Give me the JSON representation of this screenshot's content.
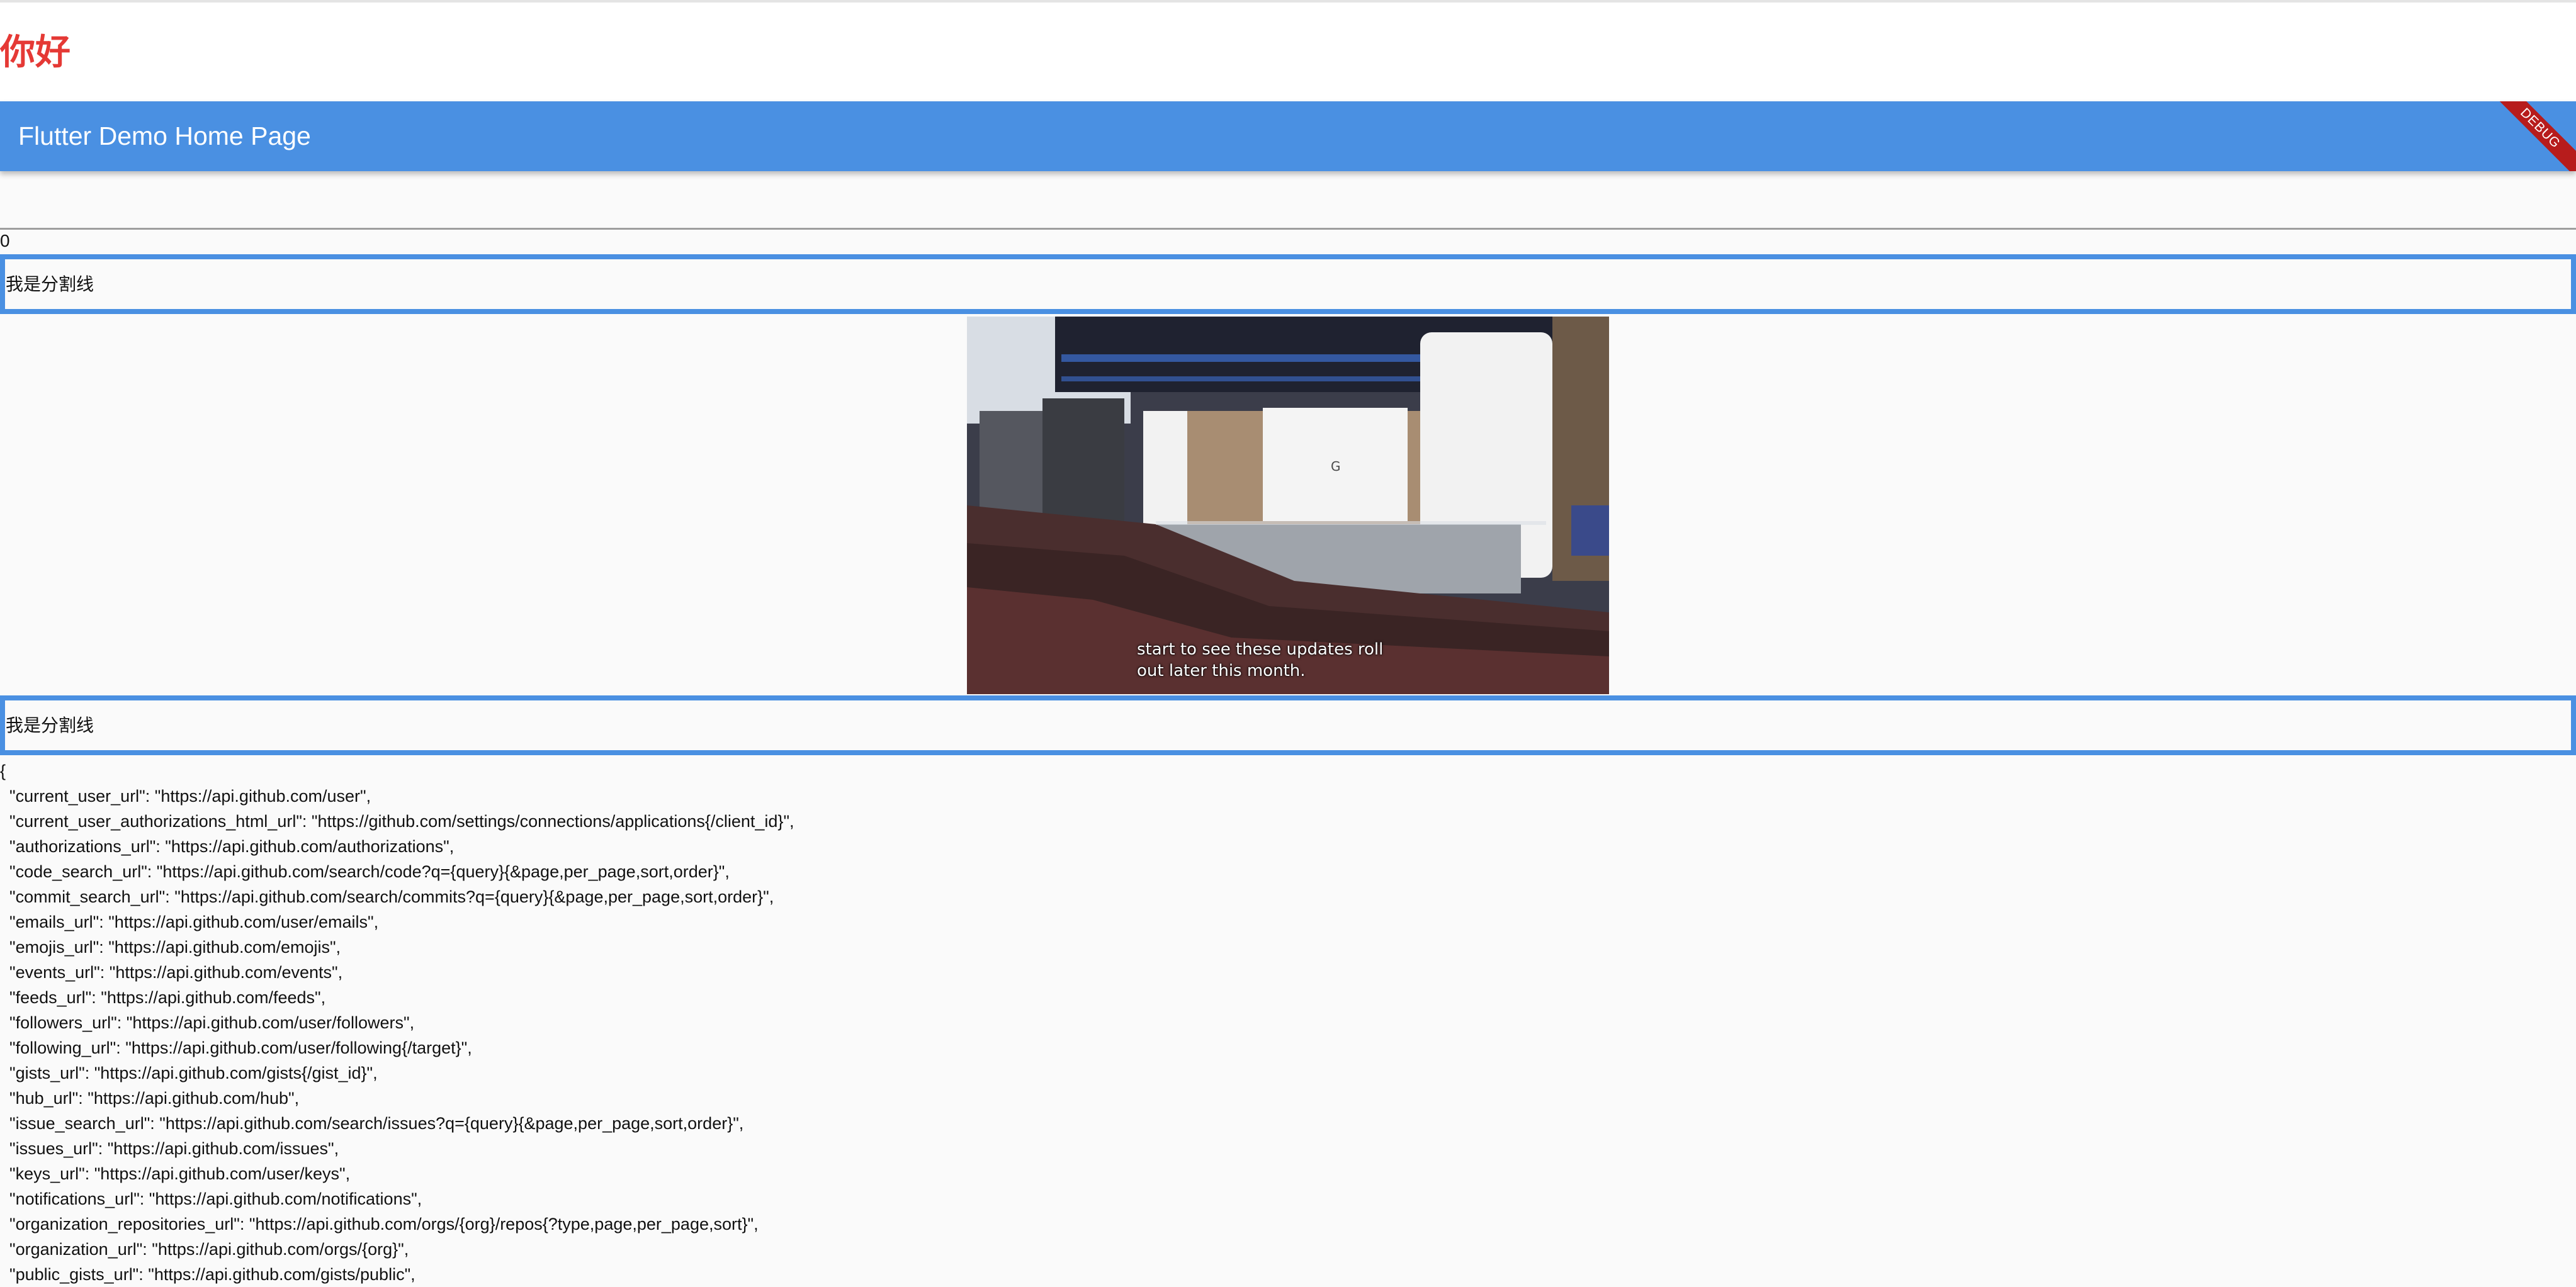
{
  "page": {
    "greeting": "你好"
  },
  "appbar": {
    "title": "Flutter Demo Home Page",
    "debug_banner": "DEBUG",
    "color": "#4a90e2"
  },
  "input": {
    "value": "",
    "placeholder": ""
  },
  "counter": "0",
  "dividers": [
    {
      "label": "我是分割线"
    },
    {
      "label": "我是分割线"
    }
  ],
  "video": {
    "caption_line1": "start to see these updates roll",
    "caption_line2": "out later this month."
  },
  "json_response": {
    "lines": [
      "{",
      "  \"current_user_url\": \"https://api.github.com/user\",",
      "  \"current_user_authorizations_html_url\": \"https://github.com/settings/connections/applications{/client_id}\",",
      "  \"authorizations_url\": \"https://api.github.com/authorizations\",",
      "  \"code_search_url\": \"https://api.github.com/search/code?q={query}{&page,per_page,sort,order}\",",
      "  \"commit_search_url\": \"https://api.github.com/search/commits?q={query}{&page,per_page,sort,order}\",",
      "  \"emails_url\": \"https://api.github.com/user/emails\",",
      "  \"emojis_url\": \"https://api.github.com/emojis\",",
      "  \"events_url\": \"https://api.github.com/events\",",
      "  \"feeds_url\": \"https://api.github.com/feeds\",",
      "  \"followers_url\": \"https://api.github.com/user/followers\",",
      "  \"following_url\": \"https://api.github.com/user/following{/target}\",",
      "  \"gists_url\": \"https://api.github.com/gists{/gist_id}\",",
      "  \"hub_url\": \"https://api.github.com/hub\",",
      "  \"issue_search_url\": \"https://api.github.com/search/issues?q={query}{&page,per_page,sort,order}\",",
      "  \"issues_url\": \"https://api.github.com/issues\",",
      "  \"keys_url\": \"https://api.github.com/user/keys\",",
      "  \"notifications_url\": \"https://api.github.com/notifications\",",
      "  \"organization_repositories_url\": \"https://api.github.com/orgs/{org}/repos{?type,page,per_page,sort}\",",
      "  \"organization_url\": \"https://api.github.com/orgs/{org}\",",
      "  \"public_gists_url\": \"https://api.github.com/gists/public\","
    ]
  }
}
